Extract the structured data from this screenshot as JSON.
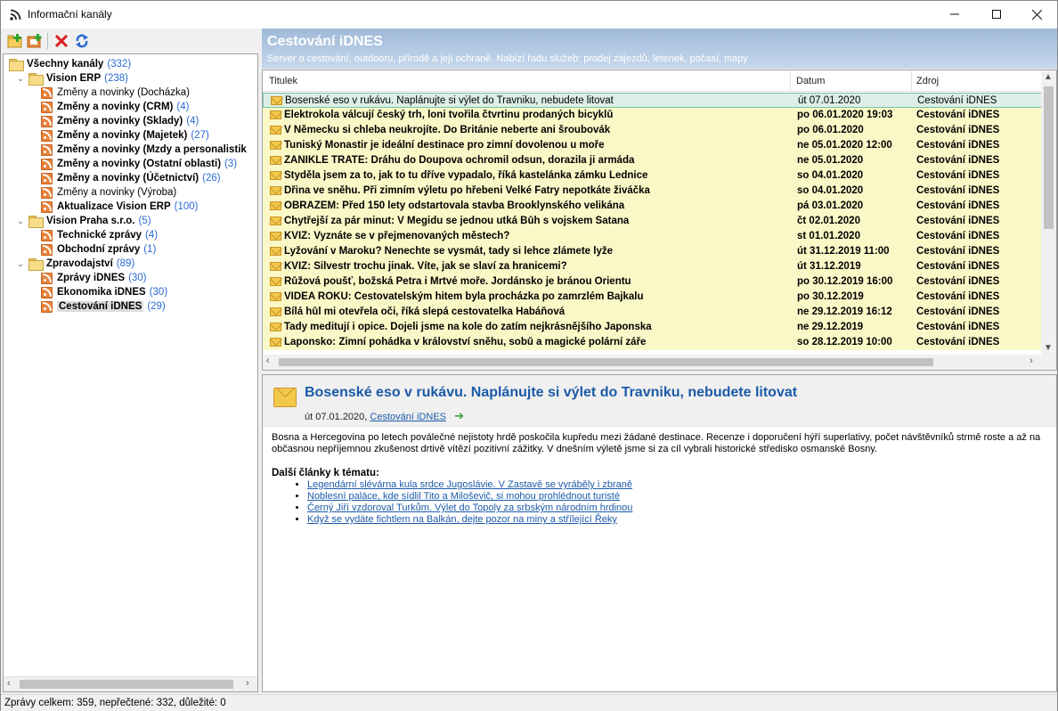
{
  "window": {
    "title": "Informační kanály"
  },
  "toolbar": {
    "icons": [
      "add-feed-icon",
      "add-folder-icon",
      "delete-icon",
      "refresh-icon"
    ]
  },
  "tree": [
    {
      "label": "Všechny kanály",
      "count": "(332)",
      "bold": true,
      "level": 0,
      "type": "folder",
      "expander": ""
    },
    {
      "label": "Vision ERP",
      "count": "(238)",
      "bold": true,
      "level": 1,
      "type": "folder",
      "expander": "v"
    },
    {
      "label": "Změny a novinky (Docházka)",
      "count": "",
      "bold": false,
      "level": 2,
      "type": "rss"
    },
    {
      "label": "Změny a novinky (CRM)",
      "count": "(4)",
      "bold": true,
      "level": 2,
      "type": "rss"
    },
    {
      "label": "Změny a novinky (Sklady)",
      "count": "(4)",
      "bold": true,
      "level": 2,
      "type": "rss"
    },
    {
      "label": "Změny a novinky (Majetek)",
      "count": "(27)",
      "bold": true,
      "level": 2,
      "type": "rss"
    },
    {
      "label": "Změny a novinky (Mzdy a personalistik",
      "count": "",
      "bold": true,
      "level": 2,
      "type": "rss"
    },
    {
      "label": "Změny a novinky (Ostatní oblasti)",
      "count": "(3)",
      "bold": true,
      "level": 2,
      "type": "rss"
    },
    {
      "label": "Změny a novinky (Účetnictví)",
      "count": "(26)",
      "bold": true,
      "level": 2,
      "type": "rss"
    },
    {
      "label": "Změny a novinky (Výroba)",
      "count": "",
      "bold": false,
      "level": 2,
      "type": "rss"
    },
    {
      "label": "Aktualizace Vision ERP",
      "count": "(100)",
      "bold": true,
      "level": 2,
      "type": "rss"
    },
    {
      "label": "Vision Praha s.r.o.",
      "count": "(5)",
      "bold": true,
      "level": 1,
      "type": "folder",
      "expander": "v"
    },
    {
      "label": "Technické zprávy",
      "count": "(4)",
      "bold": true,
      "level": 2,
      "type": "rss"
    },
    {
      "label": "Obchodní zprávy",
      "count": "(1)",
      "bold": true,
      "level": 2,
      "type": "rss"
    },
    {
      "label": "Zpravodajství",
      "count": "(89)",
      "bold": true,
      "level": 1,
      "type": "folder",
      "expander": "v"
    },
    {
      "label": "Zprávy iDNES",
      "count": "(30)",
      "bold": true,
      "level": 2,
      "type": "rss"
    },
    {
      "label": "Ekonomika iDNES",
      "count": "(30)",
      "bold": true,
      "level": 2,
      "type": "rss"
    },
    {
      "label": "Cestování iDNES",
      "count": "(29)",
      "bold": true,
      "level": 2,
      "type": "rss",
      "selected": true
    }
  ],
  "feed": {
    "title": "Cestování iDNES",
    "description": "Server o cestování, outdooru, přírodě a její ochraně. Nabízí řadu služeb: prodej zájezdů, letenek, počasí, mapy"
  },
  "columns": {
    "title": "Titulek",
    "date": "Datum",
    "source": "Zdroj"
  },
  "messages": [
    {
      "title": "Bosenské eso v rukávu. Naplánujte si výlet do Travniku, nebudete litovat",
      "date": "út 07.01.2020",
      "source": "Cestování iDNES",
      "state": "selected"
    },
    {
      "title": "Elektrokola válcují český trh, loni tvořila čtvrtinu prodaných bicyklů",
      "date": "po 06.01.2020 19:03",
      "source": "Cestování iDNES",
      "state": "unread"
    },
    {
      "title": "V Německu si chleba neukrojíte. Do Británie neberte ani šroubovák",
      "date": "po 06.01.2020",
      "source": "Cestování iDNES",
      "state": "unread"
    },
    {
      "title": "Tuniský Monastir je ideální destinace pro zimní dovolenou u moře",
      "date": "ne 05.01.2020 12:00",
      "source": "Cestování iDNES",
      "state": "unread"
    },
    {
      "title": "ZANIKLÉ TRATĚ: Dráhu do Doupova ochromil odsun, dorazila ji armáda",
      "date": "ne 05.01.2020",
      "source": "Cestování iDNES",
      "state": "unread"
    },
    {
      "title": "Styděla jsem za to, jak to tu dříve vypadalo, říká kastelánka zámku Lednice",
      "date": "so 04.01.2020",
      "source": "Cestování iDNES",
      "state": "unread"
    },
    {
      "title": "Dřina ve sněhu. Při zimním výletu po hřebeni Velké Fatry nepotkáte živáčka",
      "date": "so 04.01.2020",
      "source": "Cestování iDNES",
      "state": "unread"
    },
    {
      "title": "OBRAZEM: Před 150 lety odstartovala stavba Brooklynského velikána",
      "date": "pá 03.01.2020",
      "source": "Cestování iDNES",
      "state": "unread"
    },
    {
      "title": "Chytřejší za pár minut: V Megidu se jednou utká Bůh s vojskem Satana",
      "date": "čt 02.01.2020",
      "source": "Cestování iDNES",
      "state": "unread"
    },
    {
      "title": "KVÍZ: Vyznáte se v přejmenovaných městech?",
      "date": "st 01.01.2020",
      "source": "Cestování iDNES",
      "state": "unread"
    },
    {
      "title": "Lyžování v Maroku? Nenechte se vysmát, tady si lehce zlámete lyže",
      "date": "út 31.12.2019 11:00",
      "source": "Cestování iDNES",
      "state": "unread"
    },
    {
      "title": "KVÍZ: Silvestr trochu jinak. Víte, jak se slaví za hranicemi?",
      "date": "út 31.12.2019",
      "source": "Cestování iDNES",
      "state": "unread"
    },
    {
      "title": "Růžová poušť, božská Petra i Mrtvé moře. Jordánsko je bránou Orientu",
      "date": "po 30.12.2019 16:00",
      "source": "Cestování iDNES",
      "state": "unread"
    },
    {
      "title": "VIDEA ROKU: Cestovatelským hitem byla procházka po zamrzlém Bajkalu",
      "date": "po 30.12.2019",
      "source": "Cestování iDNES",
      "state": "unread"
    },
    {
      "title": "Bílá hůl mi otevřela oči, říká slepá cestovatelka Habáňová",
      "date": "ne 29.12.2019 16:12",
      "source": "Cestování iDNES",
      "state": "unread"
    },
    {
      "title": "Tady meditují i opice. Dojeli jsme na kole do zatím nejkrásnějšího Japonska",
      "date": "ne 29.12.2019",
      "source": "Cestování iDNES",
      "state": "unread"
    },
    {
      "title": "Laponsko: Zimní pohádka v království sněhu, sobů a magické polární záře",
      "date": "so 28.12.2019 10:00",
      "source": "Cestování iDNES",
      "state": "unread"
    }
  ],
  "preview": {
    "title": "Bosenské eso v rukávu. Naplánujte si výlet do Travniku, nebudete litovat",
    "date": "út 07.01.2020,",
    "source_link": "Cestování iDNES",
    "body": "Bosna a Hercegovina po letech poválečné nejistoty hrdě poskočila kupředu mezi žádané destinace. Recenze i doporučení hýří superlativy, počet návštěvníků strmě roste a až na občasnou nepříjemnou zkušenost drtivě vítězí pozitivní zážitky. V dnešním výletě jsme si za cíl vybrali historické středisko osmanské Bosny.",
    "related_title": "Další články k tématu:",
    "related": [
      "Legendární slévárna kula srdce Jugoslávie. V Zastavě se vyráběly i zbraně",
      "Noblesní paláce, kde sídlil Tito a Miloševič, si mohou prohlédnout turisté",
      "Černý Jiří vzdoroval Turkům. Výlet do Topoly za srbským národním hrdinou",
      "Když se vydáte fichtlem na Balkán, dejte pozor na miny a střílející Řeky"
    ]
  },
  "status": "Zprávy celkem: 359, nepřečtené: 332, důležité: 0",
  "colors": {
    "unread_bg": "#fbf8c7",
    "selected_bg": "#dcefe6",
    "link": "#1c5aa8",
    "count": "#2a6ad3"
  }
}
